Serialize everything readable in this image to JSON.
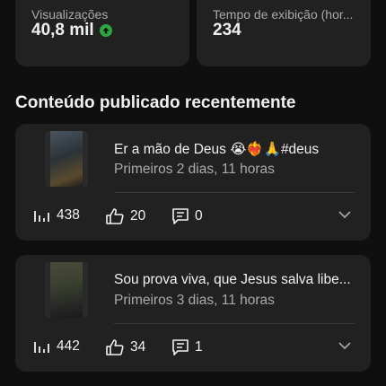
{
  "stats": {
    "views_label": "Visualizações",
    "views_value": "40,8 mil",
    "watch_label": "Tempo de exibição (hor...",
    "watch_value": "234"
  },
  "section": {
    "title": "Conteúdo publicado recentemente"
  },
  "videos": [
    {
      "title": "Er a mão de Deus 😭❤️‍🔥🙏#deus",
      "subtitle": "Primeiros 2 dias, 11 horas",
      "views": "438",
      "likes": "20",
      "comments": "0"
    },
    {
      "title": "Sou prova viva,  que Jesus salva libe...",
      "subtitle": "Primeiros 3 dias, 11 horas",
      "views": "442",
      "likes": "34",
      "comments": "1"
    }
  ],
  "colors": {
    "background": "#0f0f0f",
    "card": "#212121",
    "secondary_text": "#aaaaaa",
    "trend_up": "#2ba640"
  }
}
